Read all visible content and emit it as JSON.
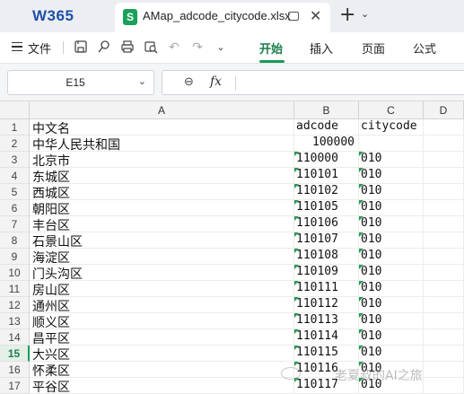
{
  "app": {
    "logo": "W365"
  },
  "tab": {
    "badge": "S",
    "title": "AMap_adcode_citycode.xlsx",
    "close_glyph": "✕",
    "new_glyph": "+",
    "chevron_glyph": "⌄"
  },
  "ribbon": {
    "file_label": "文件",
    "tabs": [
      {
        "label": "开始",
        "active": true
      },
      {
        "label": "插入",
        "active": false
      },
      {
        "label": "页面",
        "active": false
      },
      {
        "label": "公式",
        "active": false
      }
    ],
    "icons": [
      "menu-icon",
      "save-icon",
      "format-painter-icon",
      "print-icon",
      "print-preview-icon",
      "undo-icon",
      "redo-icon",
      "more-icon"
    ]
  },
  "formula_bar": {
    "name_box": "E15",
    "zoom_glyph": "⊖",
    "fx_label": "fx",
    "value": ""
  },
  "grid": {
    "columns": [
      "A",
      "B",
      "C",
      "D"
    ],
    "active_row": 15,
    "rows": [
      {
        "num": "1",
        "a": "中文名",
        "b": "adcode",
        "c": "citycode"
      },
      {
        "num": "2",
        "a": "中华人民共和国",
        "b": "100000",
        "c": ""
      },
      {
        "num": "3",
        "a": "北京市",
        "b": "110000",
        "c": "010"
      },
      {
        "num": "4",
        "a": "东城区",
        "b": "110101",
        "c": "010"
      },
      {
        "num": "5",
        "a": "西城区",
        "b": "110102",
        "c": "010"
      },
      {
        "num": "6",
        "a": "朝阳区",
        "b": "110105",
        "c": "010"
      },
      {
        "num": "7",
        "a": "丰台区",
        "b": "110106",
        "c": "010"
      },
      {
        "num": "8",
        "a": "石景山区",
        "b": "110107",
        "c": "010"
      },
      {
        "num": "9",
        "a": "海淀区",
        "b": "110108",
        "c": "010"
      },
      {
        "num": "10",
        "a": "门头沟区",
        "b": "110109",
        "c": "010"
      },
      {
        "num": "11",
        "a": "房山区",
        "b": "110111",
        "c": "010"
      },
      {
        "num": "12",
        "a": "通州区",
        "b": "110112",
        "c": "010"
      },
      {
        "num": "13",
        "a": "顺义区",
        "b": "110113",
        "c": "010"
      },
      {
        "num": "14",
        "a": "昌平区",
        "b": "110114",
        "c": "010"
      },
      {
        "num": "15",
        "a": "大兴区",
        "b": "110115",
        "c": "010"
      },
      {
        "num": "16",
        "a": "怀柔区",
        "b": "110116",
        "c": "010"
      },
      {
        "num": "17",
        "a": "平谷区",
        "b": "110117",
        "c": "010"
      }
    ]
  },
  "watermark": {
    "text": "老夏叔的AI之旅"
  },
  "colors": {
    "accent": "#1a9a5a",
    "logo": "#1f4fa8",
    "text_indicator": "#1f9e4f"
  }
}
